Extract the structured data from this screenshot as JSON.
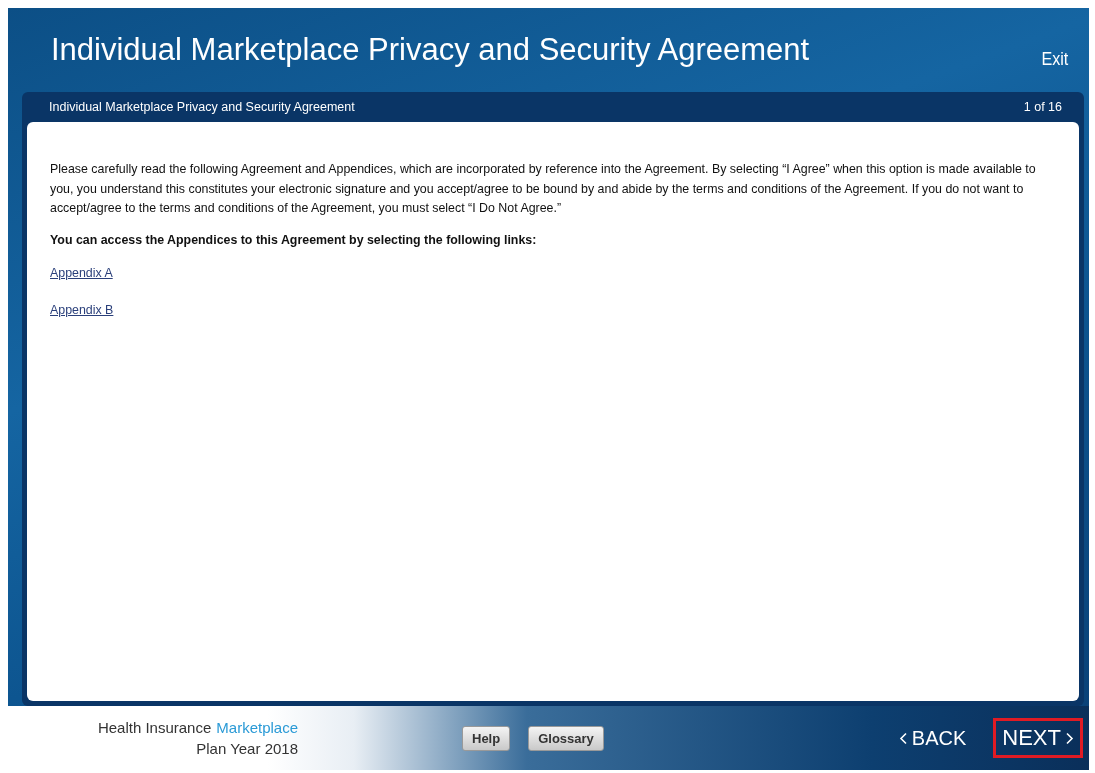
{
  "header": {
    "title": "Individual Marketplace Privacy and Security Agreement",
    "exit": "Exit"
  },
  "panel": {
    "title": "Individual Marketplace Privacy and Security Agreement",
    "progress": "1 of 16",
    "intro": "Please carefully read the following Agreement and Appendices, which are incorporated by reference into the Agreement. By selecting “I Agree” when this option is made available to you, you understand this constitutes your electronic signature and you accept/agree to be bound by and abide by the terms and conditions of the Agreement. If you do not want to accept/agree to the terms and conditions of the Agreement, you must select “I Do Not Agree.”",
    "links_heading": "You can access the Appendices to this Agreement by selecting the following links:",
    "links": [
      "Appendix A",
      "Appendix B"
    ]
  },
  "footer": {
    "brand": "Health Insurance",
    "brand_accent": "Marketplace",
    "plan_year": "Plan Year 2018",
    "buttons": [
      {
        "label": "Help"
      },
      {
        "label": "Glossary"
      }
    ],
    "nav": [
      {
        "label": "BACK",
        "kind": "back",
        "highlighted": false
      },
      {
        "label": "NEXT",
        "kind": "next",
        "highlighted": true
      }
    ]
  }
}
